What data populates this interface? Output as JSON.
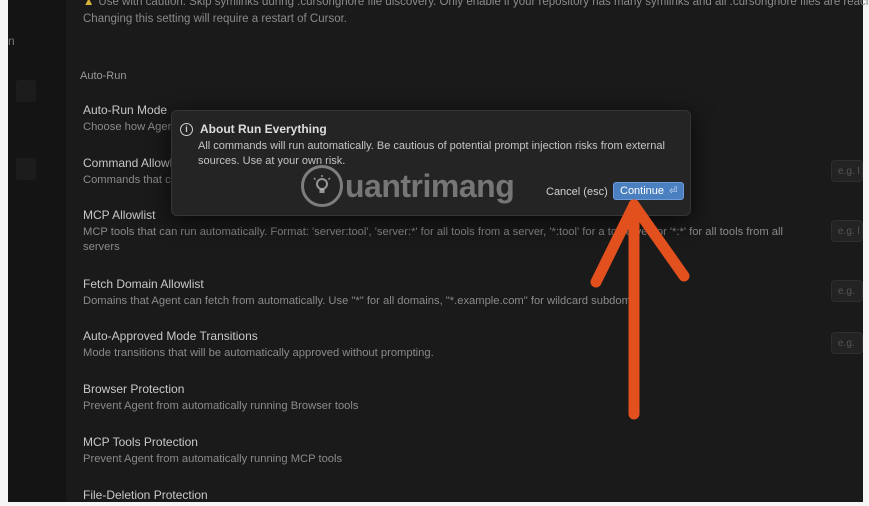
{
  "sidebar": {
    "fragment_top": "n"
  },
  "warning": {
    "line1": "Use with caution. Skip symlinks during .cursorignore file discovery. Only enable if your repository has many symlinks and all .cursorignore files are reachable v",
    "line2": "Changing this setting will require a restart of Cursor."
  },
  "section": {
    "label": "Auto-Run"
  },
  "settings": [
    {
      "title": "Auto-Run Mode",
      "desc": "Choose how Ager"
    },
    {
      "title": "Command Allowli",
      "desc": "Commands that c"
    },
    {
      "title": "MCP Allowlist",
      "desc": "MCP tools that can run automatically. Format: 'server:tool', 'server:*' for all tools from a server, '*:tool' for a to          server, or '*:*' for all tools from all servers"
    },
    {
      "title": "Fetch Domain Allowlist",
      "desc": "Domains that Agent can fetch from automatically. Use \"*\" for all domains, \"*.example.com\" for wildcard subdomai"
    },
    {
      "title": "Auto-Approved Mode Transitions",
      "desc": "Mode transitions that will be automatically approved without prompting."
    },
    {
      "title": "Browser Protection",
      "desc": "Prevent Agent from automatically running Browser tools"
    },
    {
      "title": "MCP Tools Protection",
      "desc": "Prevent Agent from automatically running MCP tools"
    },
    {
      "title": "File-Deletion Protection",
      "desc": ""
    }
  ],
  "right_inputs": [
    {
      "placeholder": "e.g. l"
    },
    {
      "placeholder": "e.g. l"
    },
    {
      "placeholder": "e.g. s"
    },
    {
      "placeholder": "e.g. a"
    }
  ],
  "dialog": {
    "title": "About Run Everything",
    "body": "All commands will run automatically. Be cautious of potential prompt injection risks from external sources. Use at your own risk.",
    "cancel_label": "Cancel (esc)",
    "continue_label": "Continue",
    "continue_hint": "⏎"
  },
  "watermark": {
    "text": "uantrimang"
  },
  "colors": {
    "accent": "#4a7fc0",
    "annotation_arrow": "#e2501e",
    "warning_icon": "#d9b43a"
  },
  "icons": [
    "warning-icon",
    "info-icon",
    "enter-key-icon",
    "lightbulb-icon",
    "red-arrow-annotation"
  ]
}
